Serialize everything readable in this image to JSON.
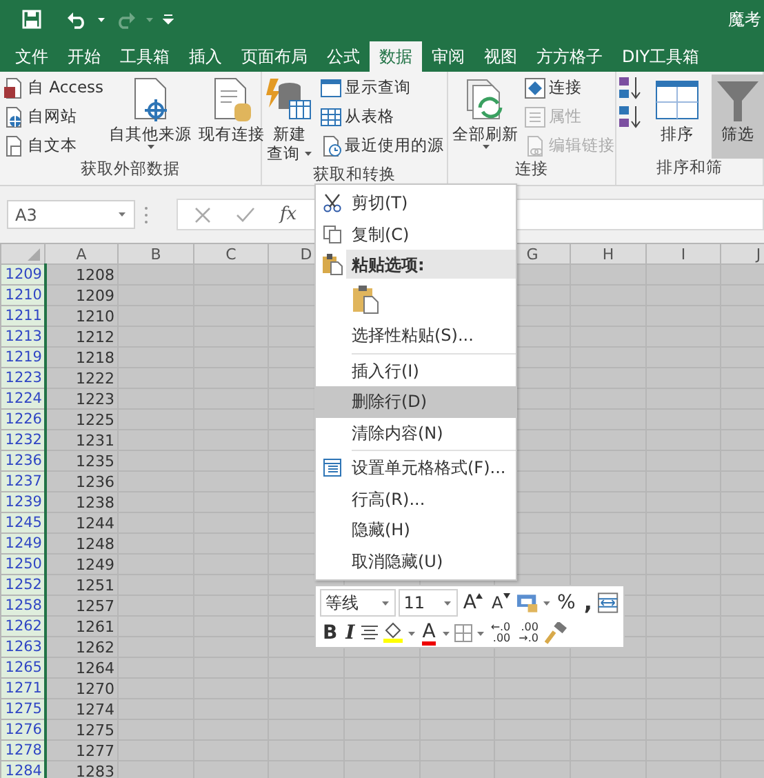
{
  "title_bar": {
    "title": "魔考"
  },
  "tabs": [
    {
      "label": "文件",
      "selected": false
    },
    {
      "label": "开始",
      "selected": false
    },
    {
      "label": "工具箱",
      "selected": false
    },
    {
      "label": "插入",
      "selected": false
    },
    {
      "label": "页面布局",
      "selected": false
    },
    {
      "label": "公式",
      "selected": false
    },
    {
      "label": "数据",
      "selected": true
    },
    {
      "label": "审阅",
      "selected": false
    },
    {
      "label": "视图",
      "selected": false
    },
    {
      "label": "方方格子",
      "selected": false
    },
    {
      "label": "DIY工具箱",
      "selected": false
    }
  ],
  "ribbon": {
    "groups": [
      {
        "label": "获取外部数据",
        "items": [
          {
            "kind": "stack",
            "buttons": [
              {
                "label": "自 Access",
                "disabled": false
              },
              {
                "label": "自网站",
                "disabled": false
              },
              {
                "label": "自文本",
                "disabled": false
              }
            ]
          },
          {
            "kind": "large",
            "lines": [
              "自其他来源"
            ],
            "dropdown": true,
            "pressed": false
          },
          {
            "kind": "large",
            "lines": [
              "现有连接"
            ],
            "dropdown": false,
            "pressed": false
          }
        ]
      },
      {
        "label": "获取和转换",
        "items": [
          {
            "kind": "large",
            "lines": [
              "新建",
              "查询"
            ],
            "dropdown": true,
            "pressed": false
          },
          {
            "kind": "stack",
            "buttons": [
              {
                "label": "显示查询",
                "disabled": false
              },
              {
                "label": "从表格",
                "disabled": false
              },
              {
                "label": "最近使用的源",
                "disabled": false
              }
            ]
          }
        ]
      },
      {
        "label": "连接",
        "items": [
          {
            "kind": "large",
            "lines": [
              "全部刷新"
            ],
            "dropdown": true,
            "pressed": false
          },
          {
            "kind": "stack",
            "buttons": [
              {
                "label": "连接",
                "disabled": false
              },
              {
                "label": "属性",
                "disabled": true
              },
              {
                "label": "编辑链接",
                "disabled": true
              }
            ]
          }
        ]
      },
      {
        "label": "排序和筛",
        "items": [
          {
            "kind": "stack",
            "buttons": [
              {
                "disabled": false
              },
              {
                "disabled": false
              }
            ]
          },
          {
            "kind": "large",
            "lines": [
              "排序"
            ],
            "dropdown": false,
            "pressed": false
          },
          {
            "kind": "large",
            "lines": [
              "筛选"
            ],
            "dropdown": false,
            "pressed": true
          }
        ]
      }
    ]
  },
  "formula_bar": {
    "name_box": "A3",
    "function_label": "fx"
  },
  "columns": [
    "A",
    "B",
    "C",
    "D"
  ],
  "columns_after_menu": [
    "G",
    "H",
    "I",
    "J"
  ],
  "rows": [
    {
      "header": "1209",
      "value": "1208",
      "selected": true
    },
    {
      "header": "1210",
      "value": "1209",
      "selected": true
    },
    {
      "header": "1211",
      "value": "1210",
      "selected": true
    },
    {
      "header": "1213",
      "value": "1212",
      "selected": true
    },
    {
      "header": "1219",
      "value": "1218",
      "selected": true
    },
    {
      "header": "1223",
      "value": "1222",
      "selected": true
    },
    {
      "header": "1224",
      "value": "1223",
      "selected": true
    },
    {
      "header": "1226",
      "value": "1225",
      "selected": true
    },
    {
      "header": "1232",
      "value": "1231",
      "selected": true
    },
    {
      "header": "1236",
      "value": "1235",
      "selected": true
    },
    {
      "header": "1237",
      "value": "1236",
      "selected": true
    },
    {
      "header": "1239",
      "value": "1238",
      "selected": true
    },
    {
      "header": "1245",
      "value": "1244",
      "selected": true
    },
    {
      "header": "1249",
      "value": "1248",
      "selected": true
    },
    {
      "header": "1250",
      "value": "1249",
      "selected": true
    },
    {
      "header": "1252",
      "value": "1251",
      "selected": true
    },
    {
      "header": "1258",
      "value": "1257",
      "selected": true
    },
    {
      "header": "1262",
      "value": "1261",
      "selected": true
    },
    {
      "header": "1263",
      "value": "1262",
      "selected": true
    },
    {
      "header": "1265",
      "value": "1264",
      "selected": true
    },
    {
      "header": "1271",
      "value": "1270",
      "selected": true
    },
    {
      "header": "1275",
      "value": "1274",
      "selected": true
    },
    {
      "header": "1276",
      "value": "1275",
      "selected": true
    },
    {
      "header": "1278",
      "value": "1277",
      "selected": true
    },
    {
      "header": "1284",
      "value": "1283",
      "selected": true
    }
  ],
  "context_menu": {
    "items": [
      {
        "kind": "item",
        "label": "剪切(T)",
        "selected": false
      },
      {
        "kind": "item",
        "label": "复制(C)",
        "selected": false
      },
      {
        "kind": "header",
        "label": "粘贴选项:"
      },
      {
        "kind": "paste-options"
      },
      {
        "kind": "item",
        "label": "选择性粘贴(S)...",
        "selected": false
      },
      {
        "kind": "separator"
      },
      {
        "kind": "item",
        "label": "插入行(I)",
        "selected": false
      },
      {
        "kind": "item",
        "label": "删除行(D)",
        "selected": true
      },
      {
        "kind": "item",
        "label": "清除内容(N)",
        "selected": false
      },
      {
        "kind": "separator"
      },
      {
        "kind": "item",
        "label": "设置单元格格式(F)...",
        "selected": false
      },
      {
        "kind": "item",
        "label": "行高(R)...",
        "selected": false
      },
      {
        "kind": "item",
        "label": "隐藏(H)",
        "selected": false
      },
      {
        "kind": "item",
        "label": "取消隐藏(U)",
        "selected": false
      }
    ]
  },
  "mini_toolbar": {
    "font_name": "等线",
    "font_size": "11",
    "grow_font": "A",
    "shrink_font": "A",
    "percent": "%",
    "comma": ",",
    "bold": "B",
    "italic": "I",
    "font_color": "A",
    "increase_decimal": [
      "←.0",
      ".00"
    ],
    "decrease_decimal": [
      ".00",
      "→.0"
    ]
  }
}
